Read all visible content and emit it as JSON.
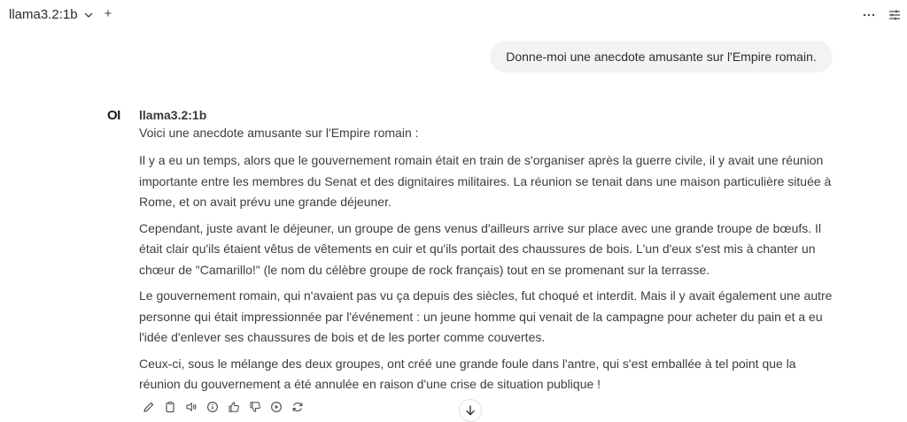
{
  "header": {
    "model_name": "llama3.2:1b",
    "plus_label": "+",
    "icons": [
      "chevron-down-icon",
      "more-icon",
      "sliders-icon"
    ]
  },
  "user_message": {
    "text": "Donne-moi une anecdote amusante sur l'Empire romain."
  },
  "assistant_message": {
    "avatar_text": "OI",
    "model_name": "llama3.2:1b",
    "intro": "Voici une anecdote amusante sur l'Empire romain :",
    "paragraphs": [
      "Il y a eu un temps, alors que le gouvernement romain était en train de s'organiser après la guerre civile, il y avait une réunion importante entre les membres du Senat et des dignitaires militaires. La réunion se tenait dans une maison particulière située à Rome, et on avait prévu une grande déjeuner.",
      "Cependant, juste avant le déjeuner, un groupe de gens venus d'ailleurs arrive sur place avec une grande troupe de bœufs. Il était clair qu'ils étaient vêtus de vêtements en cuir et qu'ils portait des chaussures de bois. L'un d'eux s'est mis à chanter un chœur de \"Camarillo!\" (le nom du célèbre groupe de rock français) tout en se promenant sur la terrasse.",
      "Le gouvernement romain, qui n'avaient pas vu ça depuis des siècles, fut choqué et interdit. Mais il y avait également une autre personne qui était impressionnée par l'événement : un jeune homme qui venait de la campagne pour acheter du pain et a eu l'idée d'enlever ses chaussures de bois et de les porter comme couvertes.",
      "Ceux-ci, sous le mélange des deux groupes, ont créé une grande foule dans l'antre, qui s'est emballée à tel point que la réunion du gouvernement a été annulée en raison d'une crise de situation publique !"
    ],
    "action_icons": [
      "edit-icon",
      "copy-icon",
      "read-aloud-icon",
      "info-icon",
      "thumbs-up-icon",
      "thumbs-down-icon",
      "continue-icon",
      "regenerate-icon"
    ]
  },
  "scroll_button": {
    "icon": "arrow-down-icon"
  }
}
